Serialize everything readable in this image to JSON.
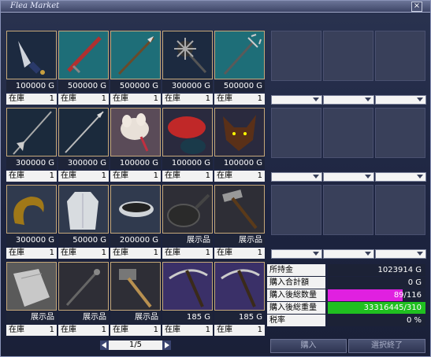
{
  "window": {
    "title": "Flea Market",
    "close_label": "×"
  },
  "items": [
    {
      "name": "dagger",
      "price": "100000 G",
      "stock_label": "在庫",
      "stock": "1",
      "bg": "#1c2a40"
    },
    {
      "name": "red-sword",
      "price": "500000 G",
      "stock_label": "在庫",
      "stock": "1",
      "bg": "#1e6e78"
    },
    {
      "name": "spear",
      "price": "500000 G",
      "stock_label": "在庫",
      "stock": "1",
      "bg": "#1e6e78"
    },
    {
      "name": "morning-star",
      "price": "300000 G",
      "stock_label": "在庫",
      "stock": "1",
      "bg": "#1c2a40"
    },
    {
      "name": "trident",
      "price": "500000 G",
      "stock_label": "在庫",
      "stock": "1",
      "bg": "#1e6e78"
    },
    {
      "name": "polearm",
      "price": "300000 G",
      "stock_label": "在庫",
      "stock": "1",
      "bg": "#1b2a3c"
    },
    {
      "name": "lance",
      "price": "300000 G",
      "stock_label": "在庫",
      "stock": "1",
      "bg": "#1b2a3c"
    },
    {
      "name": "bunny-hat",
      "price": "100000 G",
      "stock_label": "在庫",
      "stock": "1",
      "bg": "#5a4b58"
    },
    {
      "name": "red-beret",
      "price": "100000 G",
      "stock_label": "在庫",
      "stock": "1",
      "bg": "#2a2a3e"
    },
    {
      "name": "wolf-head",
      "price": "100000 G",
      "stock_label": "在庫",
      "stock": "1",
      "bg": "#2a2a3e"
    },
    {
      "name": "horns",
      "price": "300000 G",
      "stock_label": "在庫",
      "stock": "1",
      "bg": "#303a4e"
    },
    {
      "name": "robe",
      "price": "50000 G",
      "stock_label": "在庫",
      "stock": "1",
      "bg": "#303a4e"
    },
    {
      "name": "bowl",
      "price": "200000 G",
      "stock_label": "在庫",
      "stock": "1",
      "bg": "#303a4e"
    },
    {
      "name": "frying-pan",
      "price": "展示品",
      "stock_label": "在庫",
      "stock": "1",
      "bg": "#2e2e36"
    },
    {
      "name": "hammer",
      "price": "展示品",
      "stock_label": "在庫",
      "stock": "1",
      "bg": "#2e2e36"
    },
    {
      "name": "cloth",
      "price": "展示品",
      "stock_label": "在庫",
      "stock": "1",
      "bg": "#5a5a5a"
    },
    {
      "name": "wand",
      "price": "展示品",
      "stock_label": "在庫",
      "stock": "1",
      "bg": "#2e2e36"
    },
    {
      "name": "mallet",
      "price": "展示品",
      "stock_label": "在庫",
      "stock": "1",
      "bg": "#2e2e36"
    },
    {
      "name": "pickaxe",
      "price": "185 G",
      "stock_label": "在庫",
      "stock": "1",
      "bg": "#3a3068"
    },
    {
      "name": "pickaxe",
      "price": "185 G",
      "stock_label": "在庫",
      "stock": "1",
      "bg": "#3a3068"
    }
  ],
  "pager": {
    "label": "1/5"
  },
  "summary": {
    "money_label": "所持金",
    "money_value": "1023914 G",
    "total_label": "購入合計額",
    "total_value": "0 G",
    "count_label": "購入後総数量",
    "count_value": "89/116",
    "count_fraction": 0.767,
    "count_color": "#e020e0",
    "weight_label": "購入後総重量",
    "weight_value": "33316445/310",
    "weight_fraction": 1.0,
    "weight_color": "#20c020",
    "tax_label": "税率",
    "tax_value": "0 %"
  },
  "buttons": {
    "buy": "購入",
    "select_end": "選択終了"
  }
}
